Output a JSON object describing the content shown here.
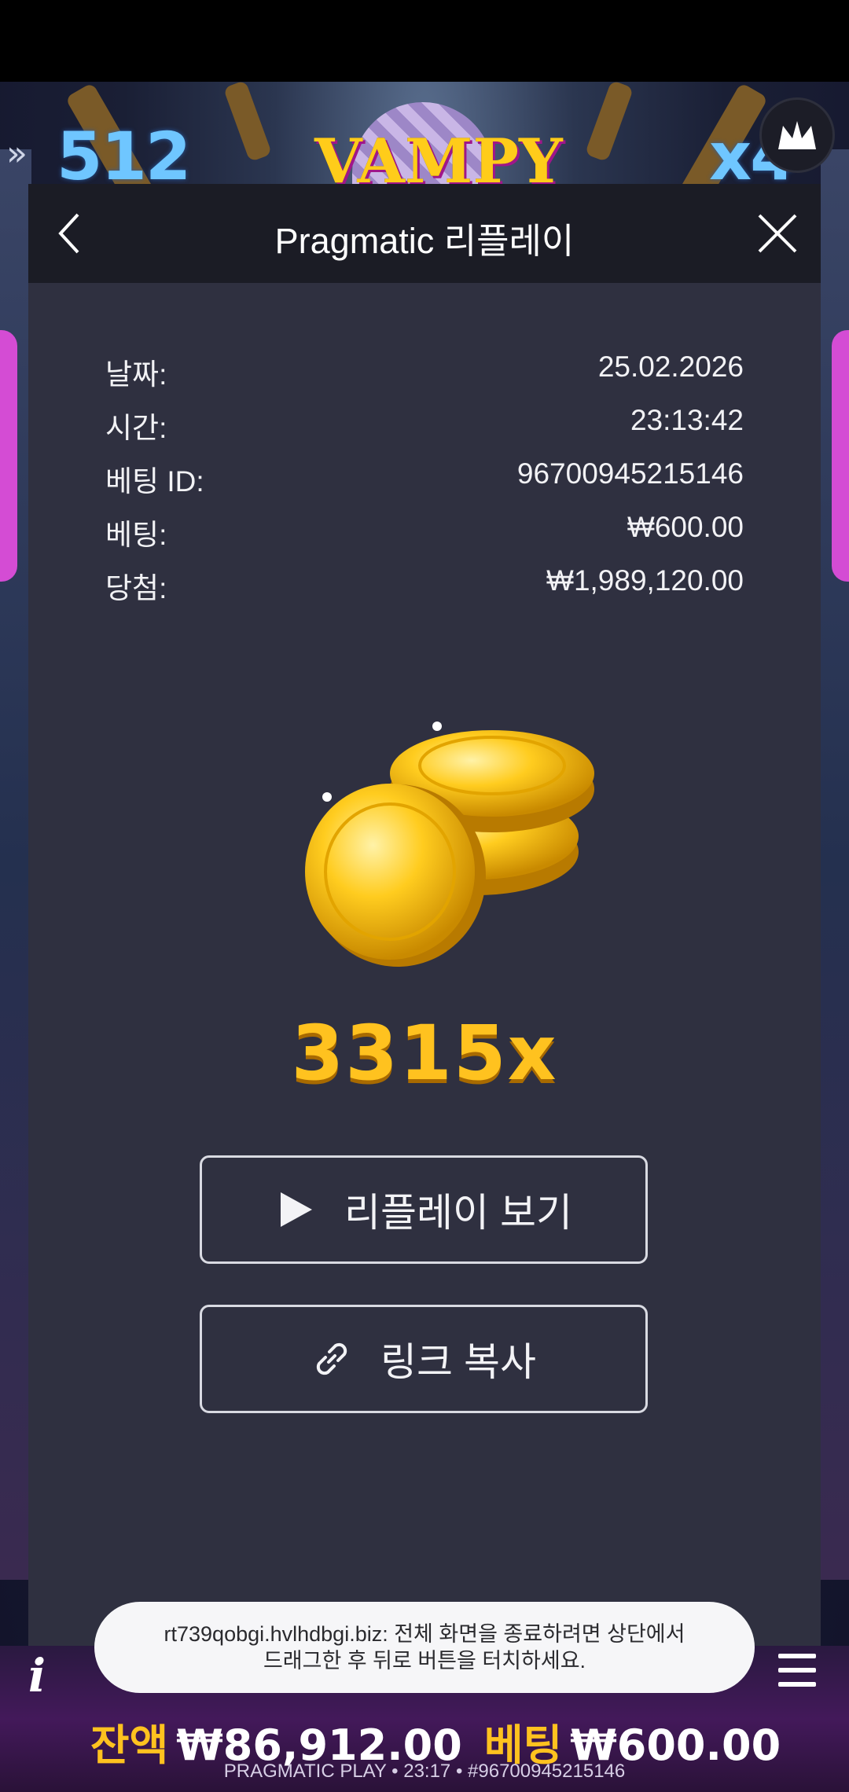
{
  "game": {
    "left_counter": "512",
    "right_counter": "x4",
    "logo": "VAMPY",
    "arrows": "»"
  },
  "modal": {
    "title": "Pragmatic 리플레이",
    "rows": [
      {
        "label": "날짜:",
        "value": "25.02.2026"
      },
      {
        "label": "시간:",
        "value": "23:13:42"
      },
      {
        "label": "베팅 ID:",
        "value": "96700945215146"
      },
      {
        "label": "베팅:",
        "value": "₩600.00"
      },
      {
        "label": "당첨:",
        "value": "₩1,989,120.00"
      }
    ],
    "multiplier": "3315x",
    "replay_button": "리플레이 보기",
    "copy_link_button": "링크 복사"
  },
  "toast": {
    "line1": "rt739qobgi.hvlhdbgi.biz: 전체 화면을 종료하려면 상단에서",
    "line2": "드래그한 후 뒤로 버튼을 터치하세요."
  },
  "bottom": {
    "info": "i",
    "balance_label": "잔액",
    "balance_value": "₩86,912.00",
    "bet_label": "베팅",
    "bet_value": "₩600.00",
    "footer": "PRAGMATIC PLAY • 23:17 • #96700945215146"
  },
  "colors": {
    "modal_bg": "#2f3040",
    "header_bg": "#1b1c25",
    "gold": "#ffc21f",
    "accent_blue": "#6fc6ff"
  }
}
